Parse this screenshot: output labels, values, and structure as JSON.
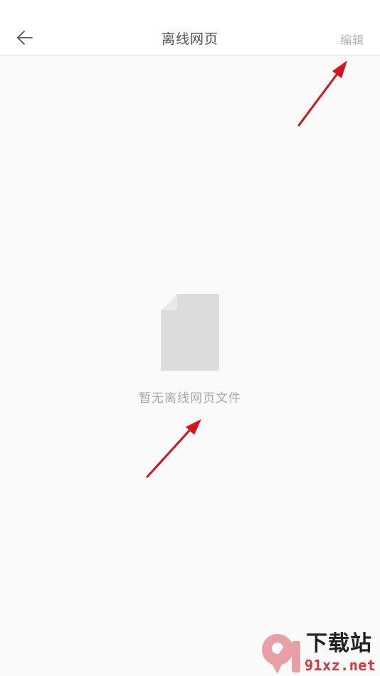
{
  "header": {
    "title": "离线网页",
    "edit_label": "编辑",
    "back_icon": "arrow-left-icon"
  },
  "empty_state": {
    "icon": "blank-document-icon",
    "message": "暂无离线网页文件"
  },
  "annotations": {
    "arrow_color": "#d8141a"
  },
  "watermark": {
    "logo_text": "9",
    "title": "下载站",
    "url": "91xz.net",
    "brand_color": "#d83238"
  },
  "colors": {
    "background": "#fafafa",
    "header_bg": "#ffffff",
    "title": "#505050",
    "edit": "#b3b3b3",
    "empty_icon": "#dcdcdc",
    "empty_text": "#a8a8a8"
  }
}
